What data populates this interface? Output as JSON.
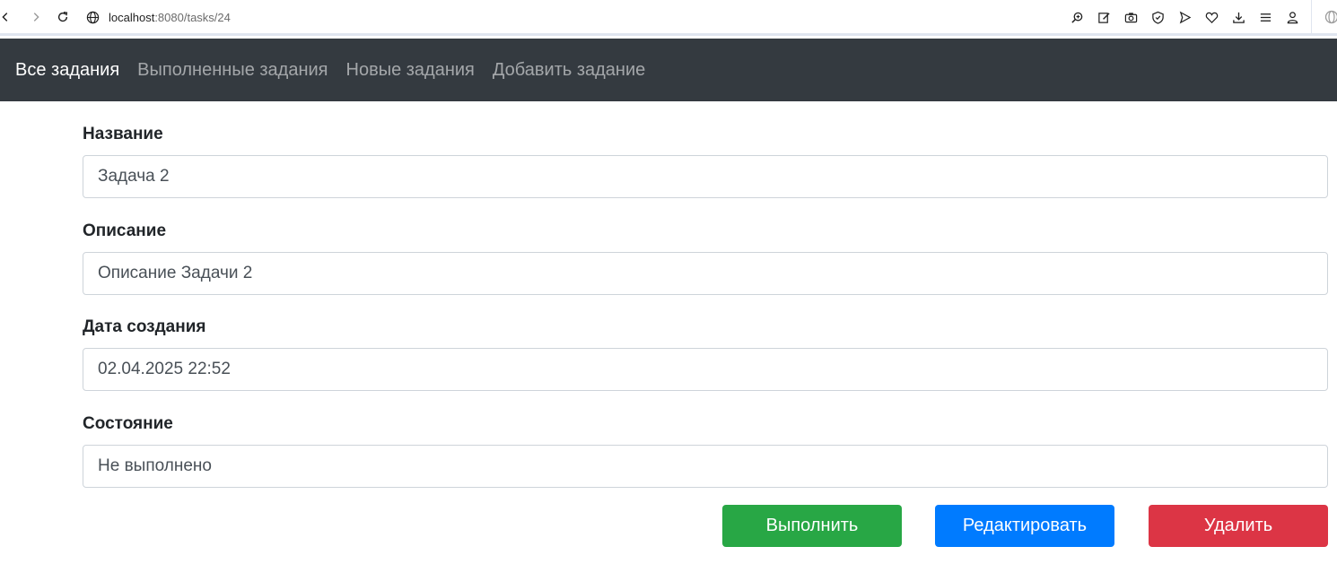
{
  "browser": {
    "url_host": "localhost",
    "url_path": ":8080/tasks/24"
  },
  "navbar": {
    "items": [
      {
        "label": "Все задания",
        "active": true
      },
      {
        "label": "Выполненные задания",
        "active": false
      },
      {
        "label": "Новые задания",
        "active": false
      },
      {
        "label": "Добавить задание",
        "active": false
      }
    ]
  },
  "form": {
    "fields": [
      {
        "label": "Название",
        "value": "Задача 2"
      },
      {
        "label": "Описание",
        "value": "Описание Задачи 2"
      },
      {
        "label": "Дата создания",
        "value": "02.04.2025 22:52"
      },
      {
        "label": "Состояние",
        "value": "Не выполнено"
      }
    ]
  },
  "actions": {
    "complete_label": "Выполнить",
    "edit_label": "Редактировать",
    "delete_label": "Удалить"
  },
  "colors": {
    "navbar_bg": "#343a40",
    "success": "#28a745",
    "primary": "#007bff",
    "danger": "#dc3545"
  }
}
